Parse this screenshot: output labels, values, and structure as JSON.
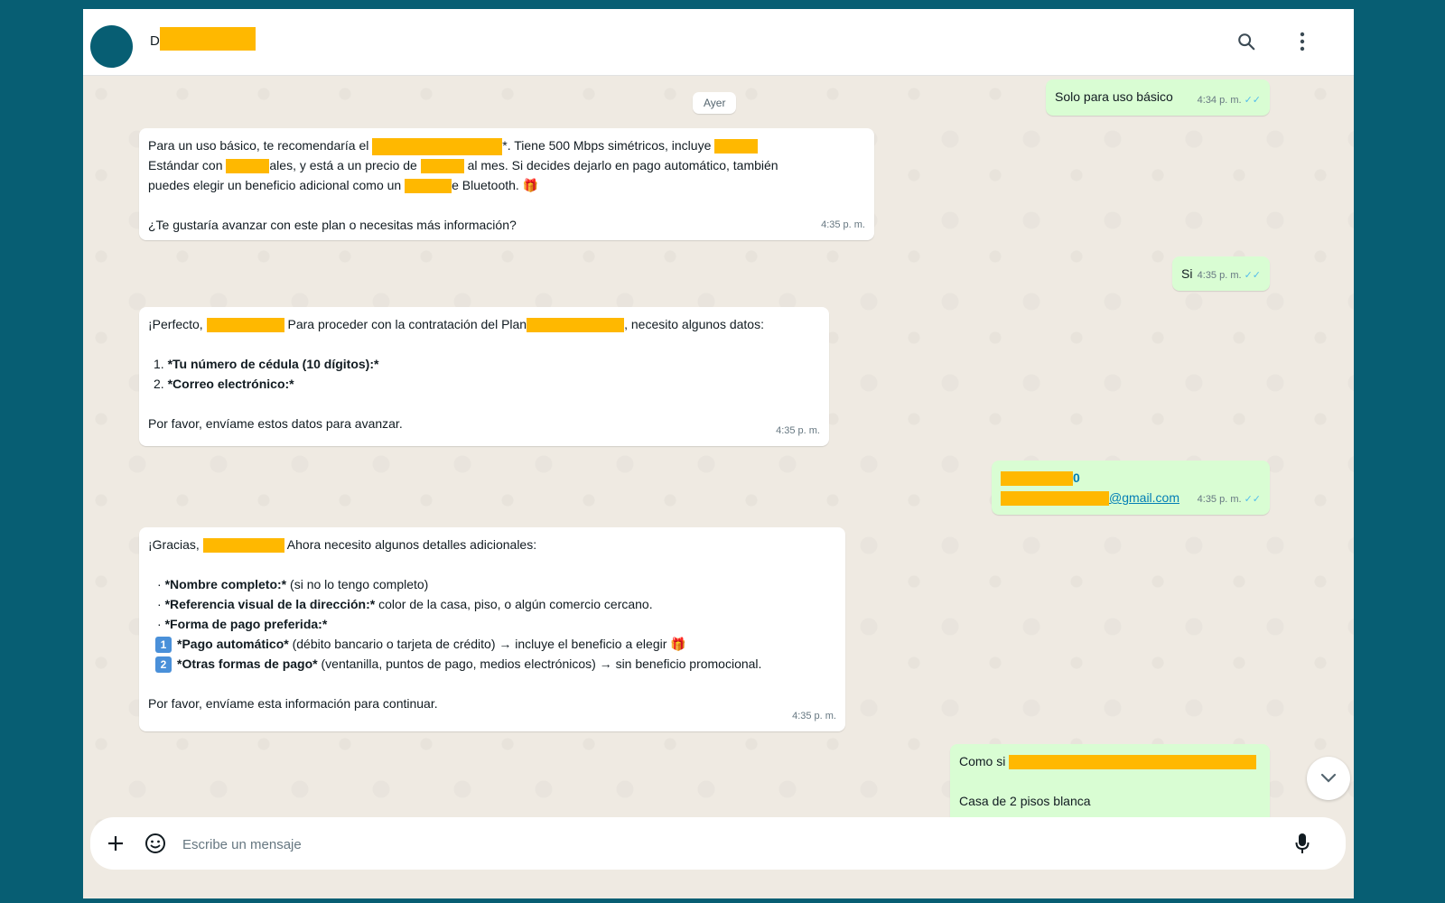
{
  "header": {
    "contact_initial": "D",
    "search_icon": "search-icon",
    "menu_icon": "menu-icon"
  },
  "chat": {
    "date_chip": "Ayer",
    "out1": {
      "text": "Solo para uso básico",
      "time": "4:34 p. m."
    },
    "in1": {
      "l1a": "Para un uso básico, te recomendaría el ",
      "l1b": "*. Tiene 500 Mbps simétricos, incluye ",
      "l2a": "Estándar con ",
      "l2b": "ales, y está a un precio de ",
      "l2c": " al mes. Si decides dejarlo en pago automático, también",
      "l3a": "puedes elegir un beneficio adicional como un ",
      "l3b": "e Bluetooth.",
      "l4": "¿Te gustaría avanzar con este plan o necesitas más información?",
      "time": "4:35 p. m."
    },
    "out2": {
      "text": "Si",
      "time": "4:35 p. m."
    },
    "in2": {
      "l1a": "¡Perfecto, ",
      "l1b": " Para proceder con la contratación del Plan",
      "l1c": ", necesito algunos datos:",
      "item1_num": "1.",
      "item1": "*Tu número de cédula (10 dígitos):*",
      "item2_num": "2.",
      "item2": "*Correo electrónico:*",
      "footer": "Por favor, envíame estos datos para avanzar.",
      "time": "4:35 p. m."
    },
    "out3": {
      "l1": "0",
      "l2": "@gmail.com",
      "time": "4:35 p. m."
    },
    "in3": {
      "l1a": "¡Gracias, ",
      "l1b": " Ahora necesito algunos detalles adicionales:",
      "b1_bold": "*Nombre completo:*",
      "b1_rest": " (si no lo tengo completo)",
      "b2_bold": "*Referencia visual de la dirección:*",
      "b2_rest": " color de la casa, piso, o algún comercio cercano.",
      "b3_bold": "*Forma de pago preferida:*",
      "o1_num": "1",
      "o1_bold": "*Pago automático*",
      "o1_rest": " (débito bancario o tarjeta de crédito) → incluye el beneficio a elegir",
      "o2_num": "2",
      "o2_bold": "*Otras formas de pago*",
      "o2_rest": " (ventanilla, puntos de pago, medios electrónicos) → sin beneficio promocional.",
      "footer": "Por favor, envíame esta información para continuar.",
      "time": "4:35 p. m."
    },
    "out4": {
      "l1": "Como si",
      "l2": "Casa de 2 pisos blanca"
    }
  },
  "composer": {
    "placeholder": "Escribe un mensaje",
    "add_icon": "plus-icon",
    "sticker_icon": "sticker-icon",
    "mic_icon": "microphone-icon"
  },
  "colors": {
    "background": "#075e73",
    "outgoing_bubble": "#d9fdd3",
    "incoming_bubble": "#ffffff",
    "redaction": "#ffb800"
  }
}
